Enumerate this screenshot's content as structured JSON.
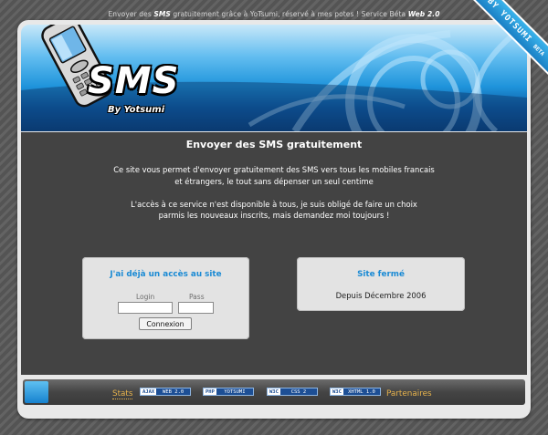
{
  "top": {
    "part1": "Envoyer des ",
    "sms_em": "SMS",
    "part2": " gratuitement grâce à YoTsumi, réservé à mes potes ! Service Béta ",
    "web": "Web 2.0"
  },
  "ribbon": {
    "text": "BY YOTSUMI",
    "beta": "BETA"
  },
  "header": {
    "logo_title": "SMS",
    "logo_sub": "By Yotsumi",
    "phone_icon": "mobile-phone-icon"
  },
  "main": {
    "title": "Envoyer des SMS gratuitement",
    "intro_lines": [
      "Ce site vous permet d'envoyer gratuitement des SMS vers tous les mobiles francais",
      "et étrangers, le tout sans dépenser un seul centime",
      "",
      "L'accès à ce service n'est disponible à tous, je suis obligé de faire un choix",
      "parmis les nouveaux inscrits, mais demandez moi toujours !"
    ]
  },
  "login_box": {
    "title": "J'ai déjà un accès au site",
    "login_label": "Login",
    "pass_label": "Pass",
    "login_value": "",
    "pass_value": "",
    "button": "Connexion"
  },
  "closed_box": {
    "title": "Site fermé",
    "text": "Depuis Décembre 2006"
  },
  "footer": {
    "stats": "Stats",
    "partners": "Partenaires",
    "badges": [
      {
        "left": "AJAX",
        "right": "WEB 2.0"
      },
      {
        "left": "PHP",
        "right": "YOTSUMI"
      },
      {
        "left": "W3C",
        "right": "CSS 2"
      },
      {
        "left": "W3C",
        "right": "XHTML 1.0"
      }
    ]
  },
  "colors": {
    "accent": "#1a8ad4",
    "link": "#e7b34c",
    "panel": "#434343"
  }
}
